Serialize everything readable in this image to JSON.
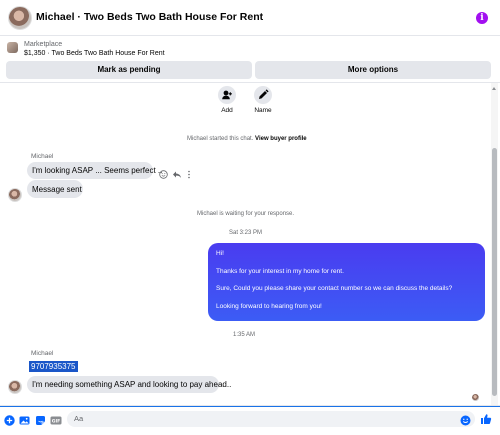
{
  "header": {
    "title": "Michael · Two Beds Two Bath House For Rent",
    "info_icon": "info-icon",
    "accent": "#a20ff0"
  },
  "marketplace": {
    "label": "Marketplace",
    "listing": "$1,350 · Two Beds Two Bath House For Rent",
    "buttons": {
      "pending": "Mark as pending",
      "more": "More options"
    }
  },
  "actions": [
    {
      "label": "Add",
      "icon": "add-person-icon"
    },
    {
      "label": "Name",
      "icon": "pencil-icon"
    }
  ],
  "conversation": {
    "started_prefix": "Michael started this chat.",
    "started_link": "View buyer profile",
    "sender_1": "Michael",
    "msg_1": "I'm looking ASAP ... Seems perfect ..",
    "msg_2": "Message sent",
    "waiting": "Michael is waiting for your response.",
    "timestamp_1": "Sat 3:23 PM",
    "outgoing": [
      "Hi!",
      "Thanks for your interest in my home for rent.",
      "Sure, Could you please share your contact number so we can discuss the details?",
      "Looking forward to hearing from you!"
    ],
    "timestamp_2": "1:35 AM",
    "sender_2": "Michael",
    "msg_3": "9707935375",
    "msg_4": "I'm needing something ASAP and looking to pay ahead.."
  },
  "composer": {
    "placeholder": "Aa"
  },
  "colors": {
    "outgoing_bubble": "#4a3cf0",
    "incoming_bubble": "#e4e6eb",
    "link_blue": "#1877f2",
    "selection": "#1a56c8"
  }
}
